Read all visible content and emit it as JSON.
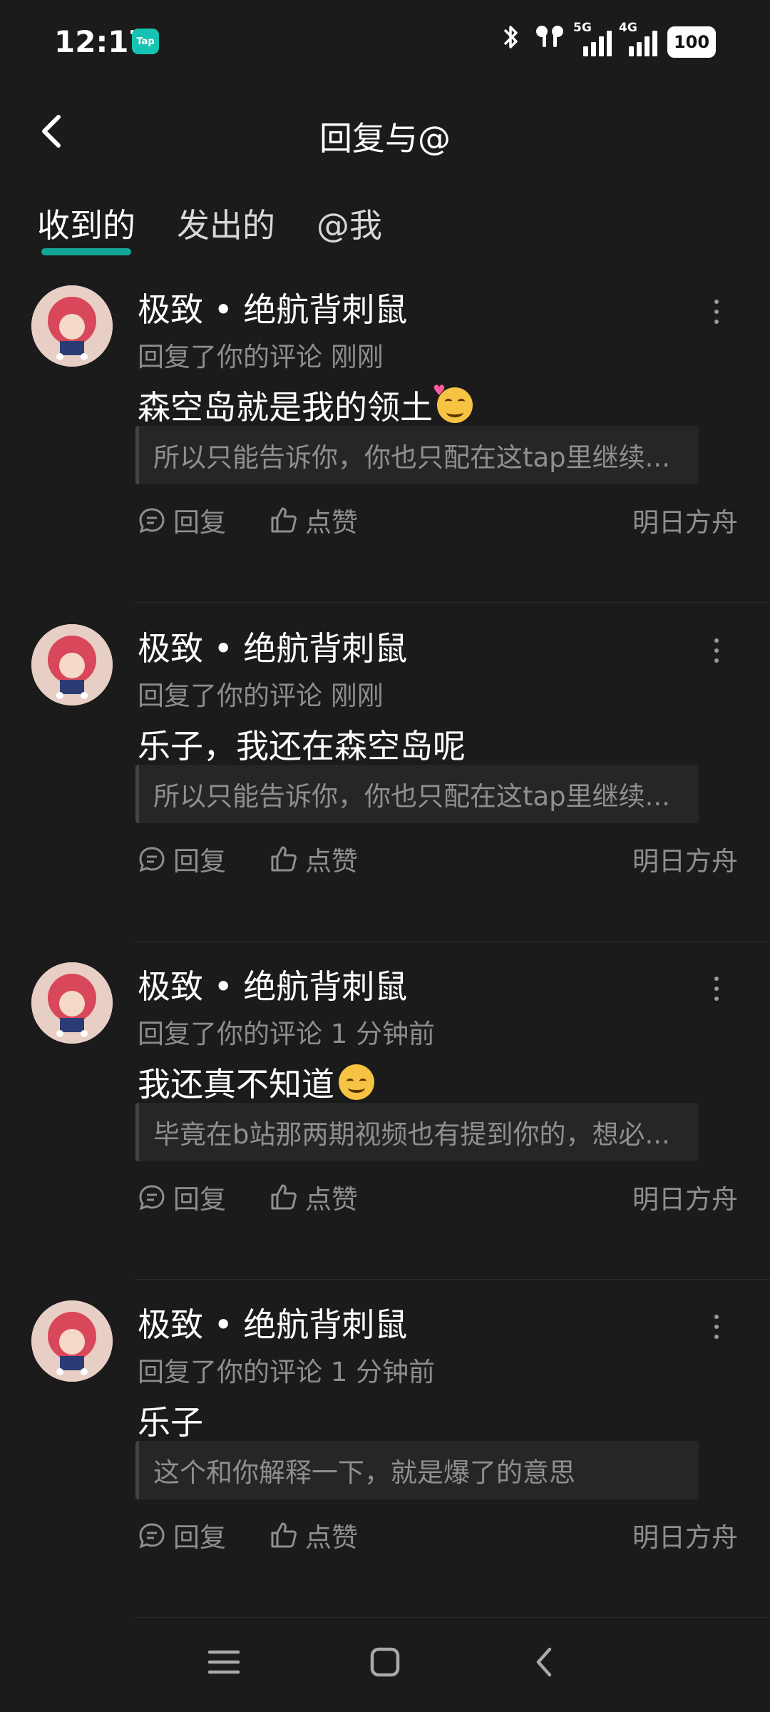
{
  "status": {
    "time": "12:17",
    "app_badge": "Tap",
    "net1": "5G",
    "net2": "4G",
    "battery": "100"
  },
  "header": {
    "title": "回复与@"
  },
  "tabs": [
    {
      "label": "收到的",
      "active": true
    },
    {
      "label": "发出的",
      "active": false
    },
    {
      "label": "@我",
      "active": false
    }
  ],
  "items": [
    {
      "user": "极致 • 绝航背刺鼠",
      "meta": "回复了你的评论 刚刚",
      "content": "森空岛就是我的领土",
      "emoji": "savoring-face-emoji",
      "quote": "所以只能告诉你，你也只配在这tap里继续...",
      "reply": "回复",
      "like": "点赞",
      "source": "明日方舟"
    },
    {
      "user": "极致 • 绝航背刺鼠",
      "meta": "回复了你的评论 刚刚",
      "content": "乐子，我还在森空岛呢",
      "emoji": "",
      "quote": "所以只能告诉你，你也只配在这tap里继续...",
      "reply": "回复",
      "like": "点赞",
      "source": "明日方舟"
    },
    {
      "user": "极致 • 绝航背刺鼠",
      "meta": "回复了你的评论 1 分钟前",
      "content": "我还真不知道",
      "emoji": "smirking-face-emoji",
      "quote": "毕竟在b站那两期视频也有提到你的，想必...",
      "reply": "回复",
      "like": "点赞",
      "source": "明日方舟"
    },
    {
      "user": "极致 • 绝航背刺鼠",
      "meta": "回复了你的评论 1 分钟前",
      "content": "乐子",
      "emoji": "",
      "quote": "这个和你解释一下，就是爆了的意思",
      "reply": "回复",
      "like": "点赞",
      "source": "明日方舟"
    }
  ],
  "icons": {
    "back": "back-arrow-icon",
    "more": "more-vertical-icon",
    "reply": "comment-icon",
    "like": "thumbs-up-icon",
    "nav": [
      "menu-icon",
      "home-square-icon",
      "back-chevron-icon"
    ]
  },
  "colors": {
    "background": "#1b1b1b",
    "accent": "#12a699",
    "secondary_text": "#8f8f8f"
  }
}
